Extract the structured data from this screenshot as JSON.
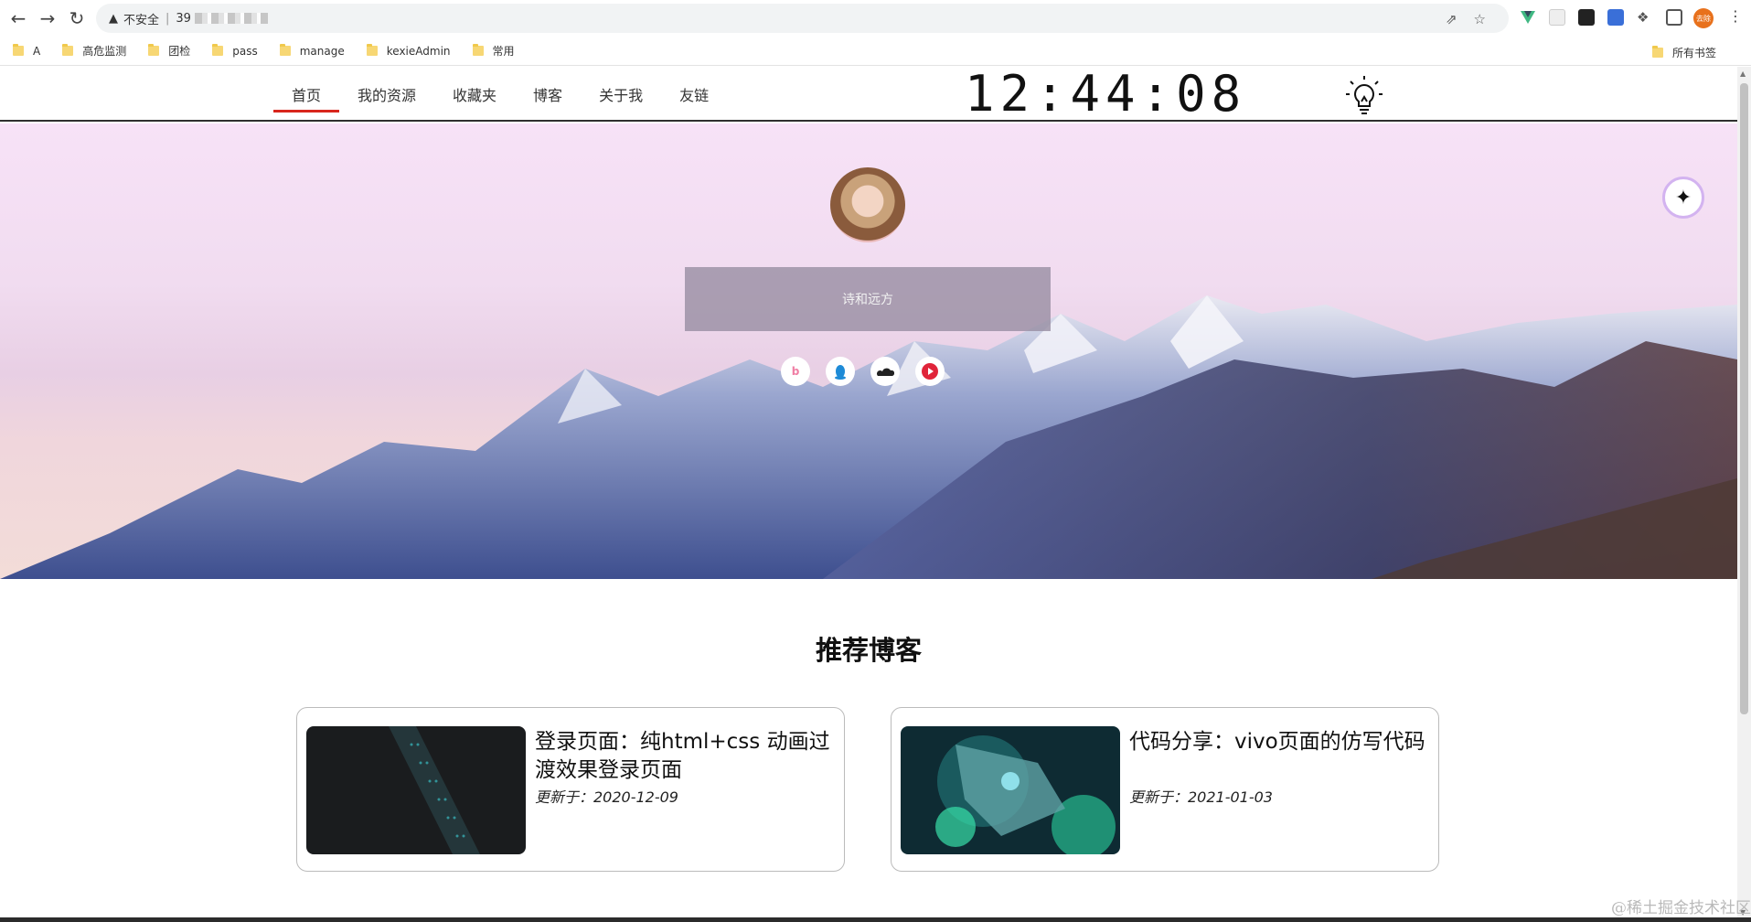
{
  "browser": {
    "security_text": "不安全",
    "url_text": "39",
    "bookmarks": [
      "A",
      "高危监测",
      "团检",
      "pass",
      "manage",
      "kexieAdmin",
      "常用"
    ],
    "all_bookmarks": "所有书签",
    "profile_label": "去除"
  },
  "nav": {
    "items": [
      "首页",
      "我的资源",
      "收藏夹",
      "博客",
      "关于我",
      "友链"
    ],
    "active": "首页"
  },
  "clock": "12:44:08",
  "hero": {
    "search_label": "诗和远方",
    "social_icons": [
      "bilibili-icon",
      "qq-icon",
      "cloud-icon",
      "music-icon"
    ]
  },
  "section": {
    "title": "推荐博客"
  },
  "cards": [
    {
      "title": "登录页面：纯html+css 动画过渡效果登录页面",
      "date": "更新于：2020-12-09"
    },
    {
      "title": "代码分享：vivo页面的仿写代码",
      "date": "更新于：2021-01-03"
    }
  ],
  "watermark": "@稀土掘金技术社区",
  "colors": {
    "accent": "#d8261d",
    "search_bg": "#968ca0"
  }
}
